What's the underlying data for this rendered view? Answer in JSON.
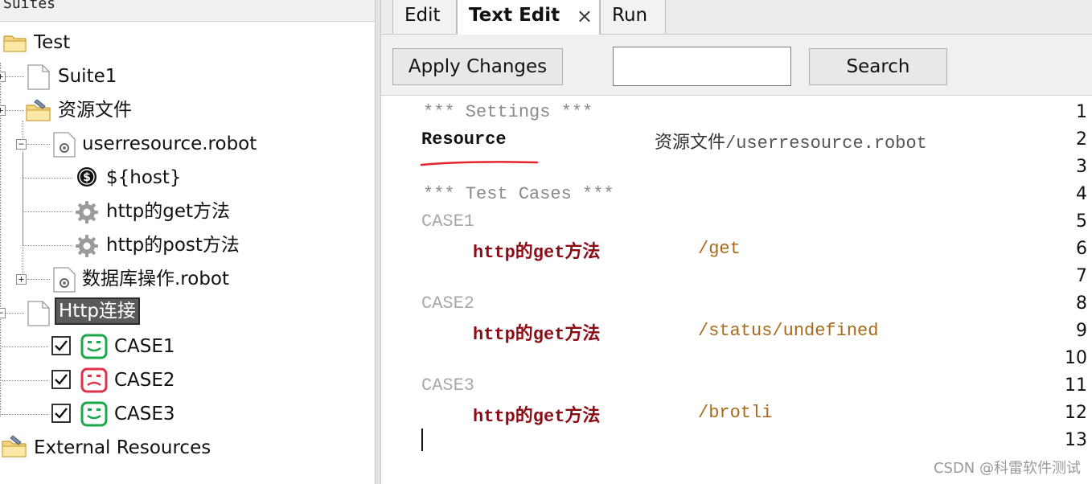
{
  "suites_panel": {
    "header": "Suites",
    "tree": {
      "test": "Test",
      "suite1": "Suite1",
      "resource_folder": "资源文件",
      "userresource_file": "userresource.robot",
      "host_var": "${host}",
      "keyword_get": "http的get方法",
      "keyword_post": "http的post方法",
      "db_file": "数据库操作.robot",
      "http_suite": "Http连接",
      "case1": "CASE1",
      "case2": "CASE2",
      "case3": "CASE3",
      "external": "External Resources"
    },
    "colors": {
      "pass": "#1aa84a",
      "fail": "#e0334a"
    }
  },
  "tabs": {
    "edit": "Edit",
    "text_edit": "Text Edit",
    "close_glyph": "×",
    "run": "Run"
  },
  "toolbar": {
    "apply_label": "Apply Changes",
    "search_value": "",
    "search_label": "Search"
  },
  "editor": {
    "line_numbers": [
      "1",
      "2",
      "3",
      "4",
      "5",
      "6",
      "7",
      "8",
      "9",
      "10",
      "11",
      "12",
      "13"
    ],
    "settings_header": "*** Settings ***",
    "resource_kw": "Resource",
    "resource_cn": "资源文件",
    "resource_path": "/userresource.robot",
    "testcases_header": "*** Test Cases ***",
    "case1": "CASE1",
    "case2": "CASE2",
    "case3": "CASE3",
    "kw": "http的get方法",
    "arg1": "/get",
    "arg2": "/status/undefined",
    "arg3": "/brotli"
  },
  "watermark": "CSDN @科雷软件测试"
}
